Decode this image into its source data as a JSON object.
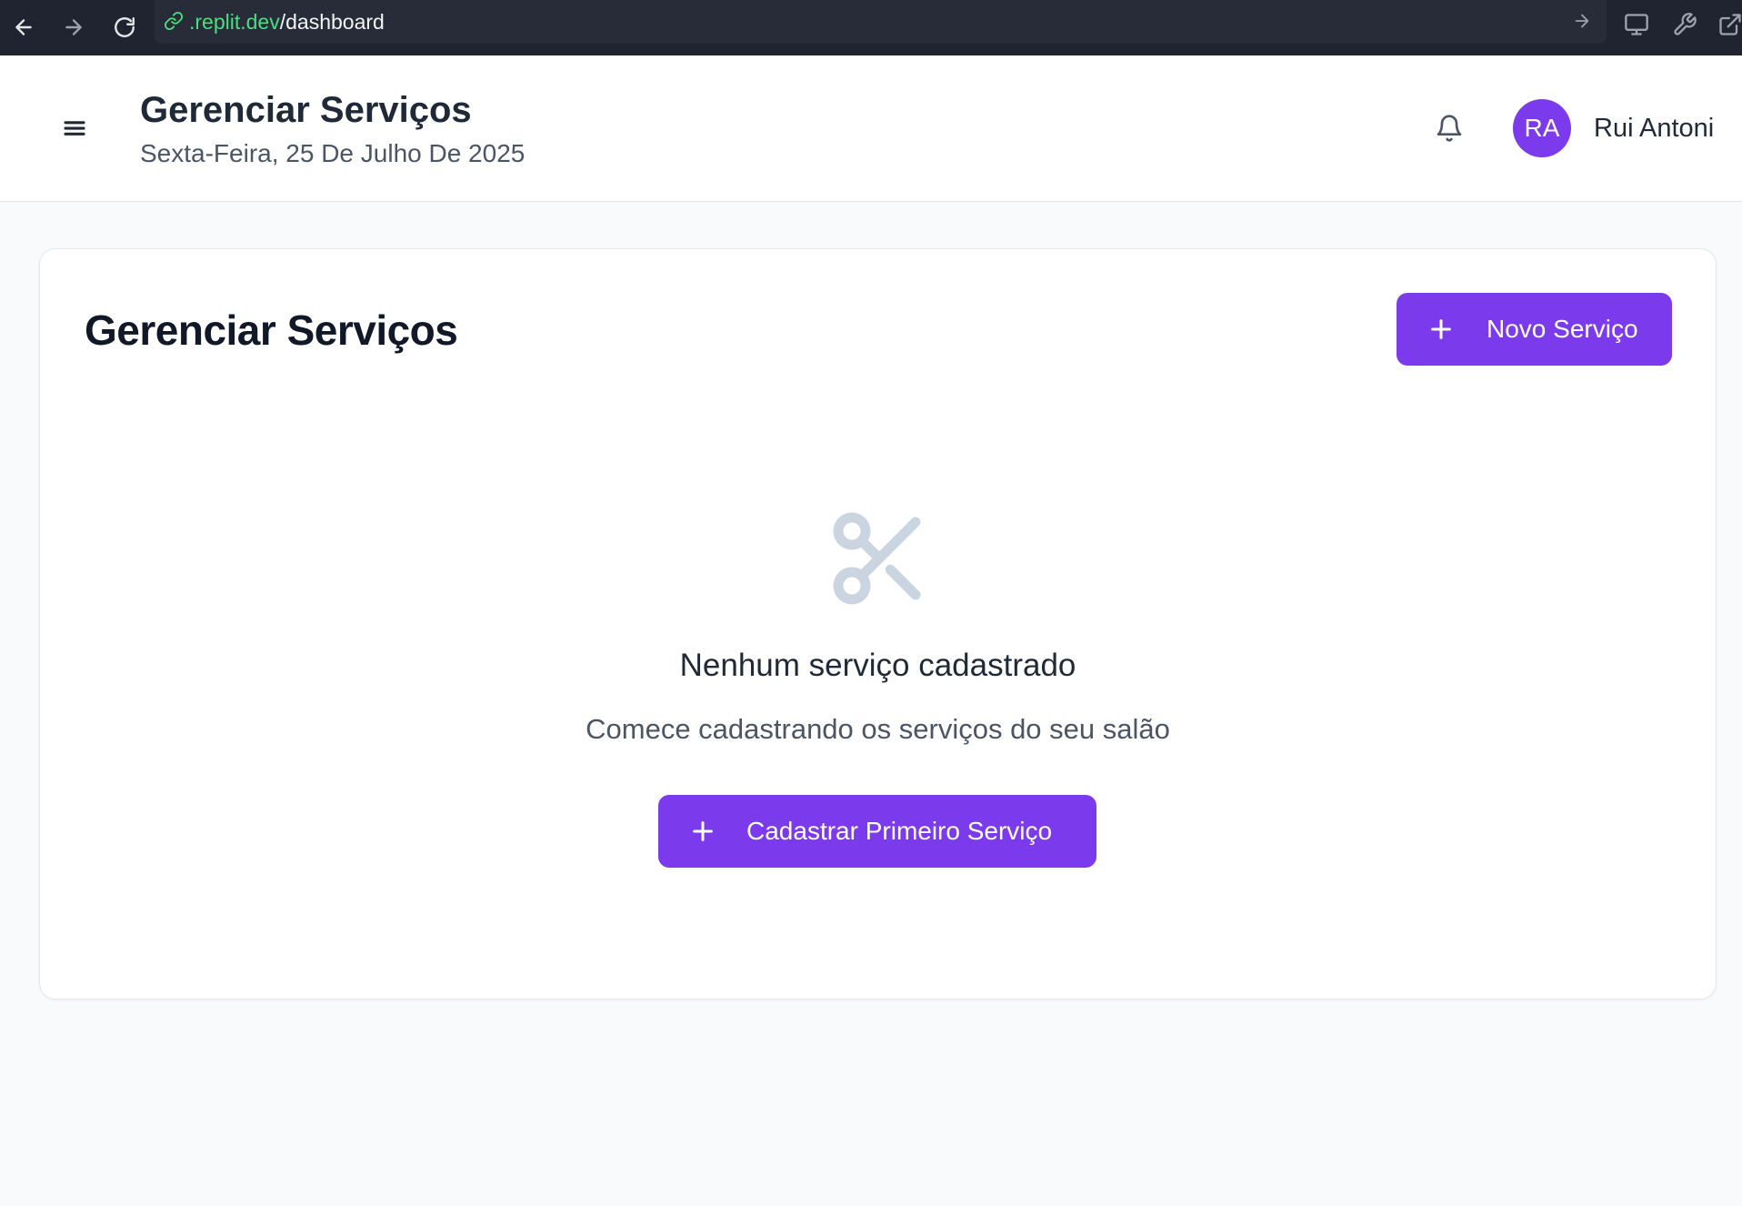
{
  "browser": {
    "url_domain": ".replit.dev",
    "url_path": "/dashboard"
  },
  "header": {
    "title": "Gerenciar Serviços",
    "date": "Sexta-Feira, 25 De Julho De 2025",
    "user": {
      "initials": "RA",
      "name": "Rui Antoni"
    }
  },
  "main": {
    "title": "Gerenciar Serviços",
    "new_button_label": "Novo Serviço",
    "empty_state": {
      "icon": "scissors-icon",
      "title": "Nenhum serviço cadastrado",
      "subtitle": "Comece cadastrando os serviços do seu salão",
      "button_label": "Cadastrar Primeiro Serviço"
    }
  },
  "colors": {
    "accent": "#7c3aed",
    "browser_bg": "#1f2430",
    "page_bg": "#f9fafb",
    "empty_icon": "#cbd5e1"
  }
}
